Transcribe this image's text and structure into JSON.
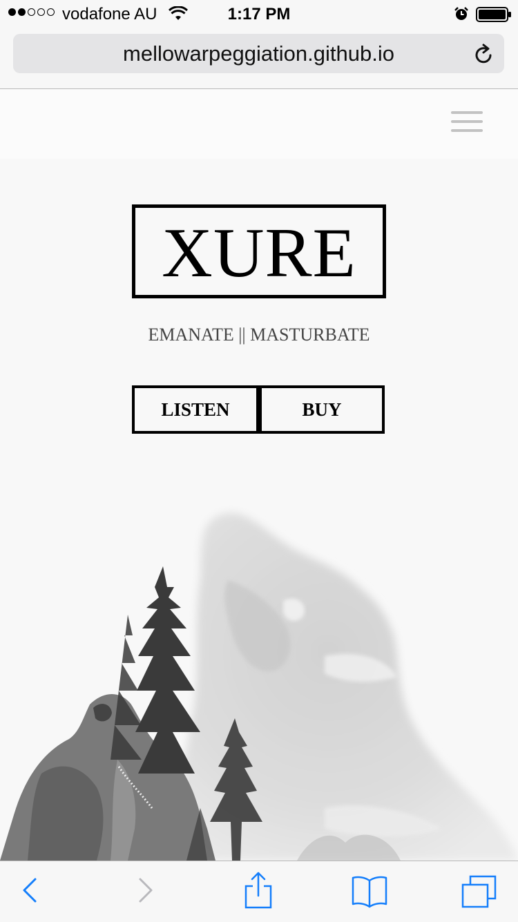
{
  "status_bar": {
    "carrier": "vodafone AU",
    "time": "1:17 PM"
  },
  "browser": {
    "url": "mellowarpeggiation.github.io"
  },
  "site": {
    "logo": "XURE",
    "tagline": "EMANATE || MASTURBATE",
    "buttons": {
      "listen": "LISTEN",
      "buy": "BUY"
    }
  },
  "colors": {
    "toolbar_accent": "#147efb",
    "disabled": "#b8b8bc"
  },
  "icons": [
    "wifi-icon",
    "alarm-icon",
    "battery-icon",
    "reload-icon",
    "menu-icon",
    "back-icon",
    "forward-icon",
    "share-icon",
    "bookmarks-icon",
    "tabs-icon"
  ]
}
